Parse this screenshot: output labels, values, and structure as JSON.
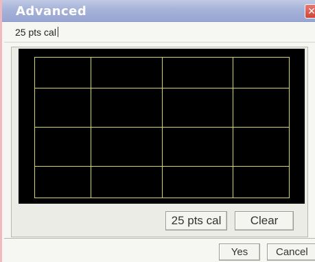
{
  "window": {
    "title": "Advanced",
    "close_glyph": "✕",
    "close_icon": "close-icon"
  },
  "header": {
    "subtitle": "25 pts cal"
  },
  "panel": {
    "grid": {
      "color": "#d8d86a",
      "columns": 4,
      "rows": 4
    },
    "buttons": {
      "calibrate": "25 pts cal",
      "clear": "Clear"
    }
  },
  "footer": {
    "yes": "Yes",
    "cancel": "Cancel"
  },
  "colors": {
    "title_bar": "#a6b2d8",
    "close_button": "#d9584b",
    "screen": "#000000"
  }
}
